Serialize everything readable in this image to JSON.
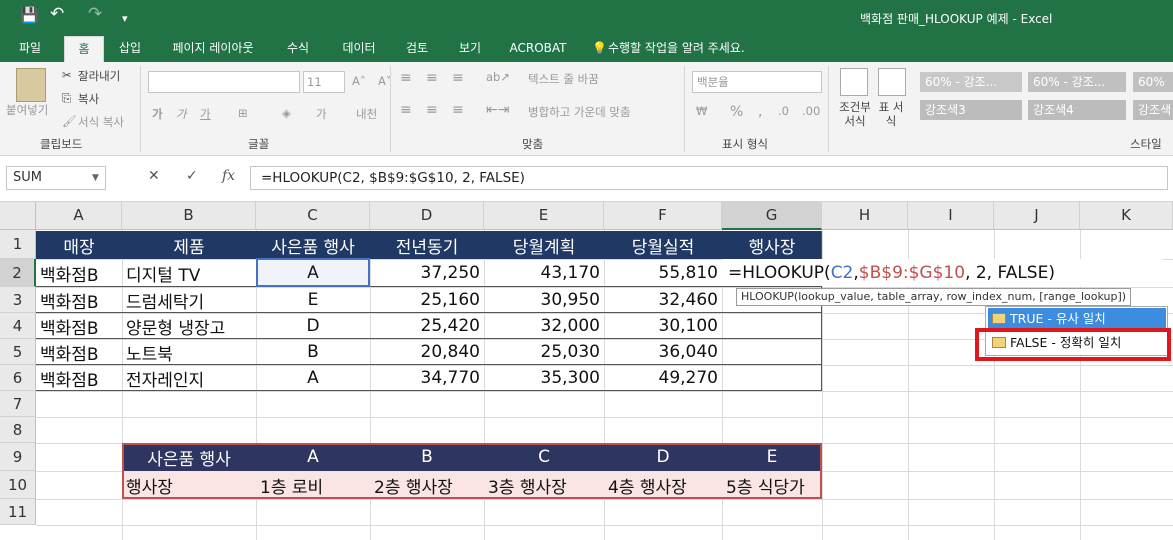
{
  "window": {
    "title": "백화점 판매_HLOOKUP 예제 - Excel",
    "qa_save": "💾",
    "qa_undo": "↶",
    "qa_redo": "↷",
    "qa_more": "▾"
  },
  "tabs": [
    "파일",
    "홈",
    "삽입",
    "페이지 레이아웃",
    "수식",
    "데이터",
    "검토",
    "보기",
    "ACROBAT",
    "수행할 작업을 알려 주세요."
  ],
  "ribbon": {
    "clipboard": {
      "paste": "붙여넣기",
      "cut": "잘라내기",
      "copy": "복사",
      "format_painter": "서식 복사",
      "label": "클립보드"
    },
    "font": {
      "font_size": "11",
      "bold": "가",
      "italic": "가",
      "underline": "가",
      "font_color": "가",
      "phonetic": "내천",
      "label": "글꼴"
    },
    "alignment": {
      "wrap": "텍스트 줄 바꿈",
      "merge": "병합하고 가운데 맞춤",
      "label": "맞춤"
    },
    "number": {
      "format": "백분율",
      "percent": "%",
      "comma": ",",
      "label": "표시 형식"
    },
    "styles": {
      "conditional": "조건부 서식",
      "table": "표 서식",
      "chips": [
        "60% - 강조...",
        "60% - 강조...",
        "60%",
        "강조색3",
        "강조색4",
        "강조색"
      ],
      "label": "스타일"
    }
  },
  "formula_bar": {
    "name_box": "SUM",
    "cancel": "✕",
    "enter": "✓",
    "fx": "fx",
    "formula": "=HLOOKUP(C2, $B$9:$G$10, 2, FALSE)"
  },
  "columns": [
    "A",
    "B",
    "C",
    "D",
    "E",
    "F",
    "G",
    "H",
    "I",
    "J",
    "K"
  ],
  "rows": [
    "1",
    "2",
    "3",
    "4",
    "5",
    "6",
    "7",
    "8",
    "9",
    "10",
    "11"
  ],
  "table1": {
    "headers": [
      "매장",
      "제품",
      "사은품 행사",
      "전년동기",
      "당월계획",
      "당월실적",
      "행사장"
    ],
    "rows": [
      [
        "백화점B",
        "디지털 TV",
        "A",
        "37,250",
        "43,170",
        "55,810"
      ],
      [
        "백화점B",
        "드럼세탁기",
        "E",
        "25,160",
        "30,950",
        "32,460"
      ],
      [
        "백화점B",
        "양문형 냉장고",
        "D",
        "25,420",
        "32,000",
        "30,100"
      ],
      [
        "백화점B",
        "노트북",
        "B",
        "20,840",
        "25,030",
        "36,040"
      ],
      [
        "백화점B",
        "전자레인지",
        "A",
        "34,770",
        "35,300",
        "49,270"
      ]
    ]
  },
  "editing_cell": {
    "prefix": "=HLOOKUP(",
    "arg1": "C2",
    "sep1": ", ",
    "arg2": "$B$9:$G$10",
    "rest": ", 2, FALSE)"
  },
  "tooltip": "HLOOKUP(lookup_value, table_array, row_index_num, [range_lookup])",
  "autocomplete": [
    "TRUE - 유사 일치",
    "FALSE - 정확히 일치"
  ],
  "table2": {
    "header": [
      "사은품 행사",
      "A",
      "B",
      "C",
      "D",
      "E"
    ],
    "row": [
      "행사장",
      "1층 로비",
      "2층 행사장",
      "3층 행사장",
      "4층 행사장",
      "5층 식당가"
    ]
  },
  "colors": {
    "excel_green": "#217346",
    "header_navy": "#1f3864",
    "table2_header": "#2d3560",
    "table2_row": "#fbe5e4",
    "ref_blue": "#4472c4",
    "ref_red": "#c0504d",
    "highlight_red": "#e0161b"
  }
}
